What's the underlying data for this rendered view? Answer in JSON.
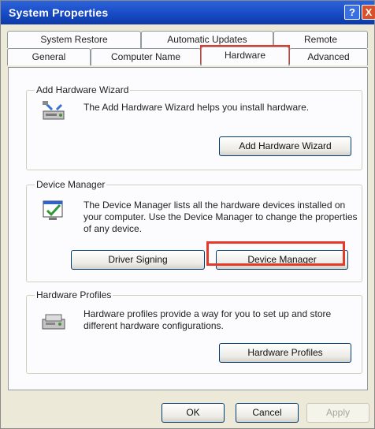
{
  "window": {
    "title": "System Properties",
    "help_label": "?",
    "close_label": "X"
  },
  "tabs_back": [
    "System Restore",
    "Automatic Updates",
    "Remote"
  ],
  "tabs_front": [
    "General",
    "Computer Name",
    "Hardware",
    "Advanced"
  ],
  "active_tab": "Hardware",
  "groups": {
    "add_hardware": {
      "title": "Add Hardware Wizard",
      "description": "The Add Hardware Wizard helps you install hardware.",
      "button": "Add Hardware Wizard"
    },
    "device_manager": {
      "title": "Device Manager",
      "description": "The Device Manager lists all the hardware devices installed on your computer. Use the Device Manager to change the properties of any device.",
      "button_left": "Driver Signing",
      "button_right": "Device Manager"
    },
    "hardware_profiles": {
      "title": "Hardware Profiles",
      "description": "Hardware profiles provide a way for you to set up and store different hardware configurations.",
      "button": "Hardware Profiles"
    }
  },
  "footer": {
    "ok": "OK",
    "cancel": "Cancel",
    "apply": "Apply"
  },
  "highlight_color": "#e53a2a"
}
